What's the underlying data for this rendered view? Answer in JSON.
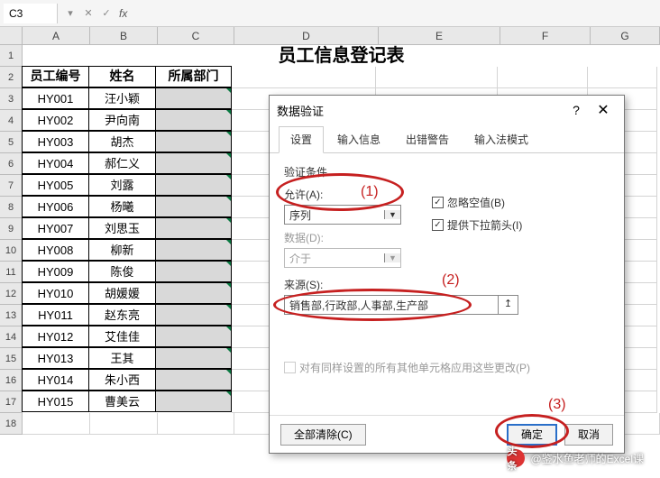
{
  "formula_bar": {
    "cell_ref": "C3",
    "fx": "fx"
  },
  "columns": [
    "A",
    "B",
    "C",
    "D",
    "E",
    "F",
    "G"
  ],
  "title": "员工信息登记表",
  "headers": {
    "col_a": "员工编号",
    "col_b": "姓名",
    "col_c": "所属部门"
  },
  "rows": [
    {
      "n": "1"
    },
    {
      "n": "2"
    },
    {
      "n": "3",
      "a": "HY001",
      "b": "汪小颖"
    },
    {
      "n": "4",
      "a": "HY002",
      "b": "尹向南"
    },
    {
      "n": "5",
      "a": "HY003",
      "b": "胡杰"
    },
    {
      "n": "6",
      "a": "HY004",
      "b": "郝仁义"
    },
    {
      "n": "7",
      "a": "HY005",
      "b": "刘露"
    },
    {
      "n": "8",
      "a": "HY006",
      "b": "杨曦"
    },
    {
      "n": "9",
      "a": "HY007",
      "b": "刘思玉"
    },
    {
      "n": "10",
      "a": "HY008",
      "b": "柳新"
    },
    {
      "n": "11",
      "a": "HY009",
      "b": "陈俊"
    },
    {
      "n": "12",
      "a": "HY010",
      "b": "胡媛媛"
    },
    {
      "n": "13",
      "a": "HY011",
      "b": "赵东亮"
    },
    {
      "n": "14",
      "a": "HY012",
      "b": "艾佳佳"
    },
    {
      "n": "15",
      "a": "HY013",
      "b": "王其"
    },
    {
      "n": "16",
      "a": "HY014",
      "b": "朱小西"
    },
    {
      "n": "17",
      "a": "HY015",
      "b": "曹美云"
    },
    {
      "n": "18"
    }
  ],
  "dialog": {
    "title": "数据验证",
    "tabs": [
      "设置",
      "输入信息",
      "出错警告",
      "输入法模式"
    ],
    "section": "验证条件",
    "allow_label": "允许(A):",
    "allow_value": "序列",
    "data_label": "数据(D):",
    "data_value": "介于",
    "ignore_blank": "忽略空值(B)",
    "dropdown_arrow": "提供下拉箭头(I)",
    "source_label": "来源(S):",
    "source_value": "销售部,行政部,人事部,生产部",
    "apply_same": "对有同样设置的所有其他单元格应用这些更改(P)",
    "clear_all": "全部清除(C)",
    "ok": "确定",
    "cancel": "取消"
  },
  "annotations": {
    "a1": "(1)",
    "a2": "(2)",
    "a3": "(3)"
  },
  "watermark": {
    "prefix": "头条",
    "text": "@鉴水鱼老师的Excel课"
  }
}
